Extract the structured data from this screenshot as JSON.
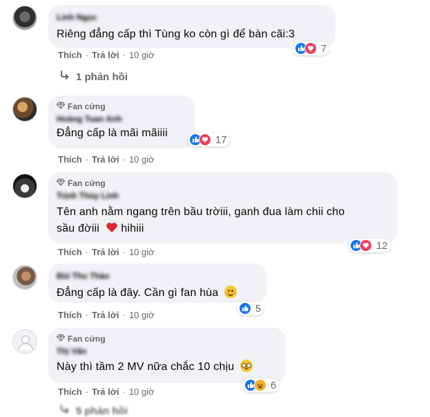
{
  "comments": [
    {
      "author": "Linh Ngọc",
      "badge": "",
      "text": "Riêng đẳng cấp thì Tùng ko còn gì để bàn cãi:3",
      "reactions": {
        "types": [
          "like",
          "love"
        ],
        "count": "7"
      },
      "like_label": "Thích",
      "reply_label": "Trả lời",
      "time": "10 giờ"
    },
    {
      "author": "Hoàng Tuan Anh",
      "badge": "Fan cứng",
      "text": "Đẳng cấp là mãi mãiiii",
      "reactions": {
        "types": [
          "like",
          "love"
        ],
        "count": "17"
      },
      "like_label": "Thích",
      "reply_label": "Trả lời",
      "time": "10 giờ"
    },
    {
      "author": "Trịnh Thùy Linh",
      "badge": "Fan cứng",
      "text_line1": "Tên anh nằm ngang trên bầu trờiii, ganh đua làm chii cho",
      "text_line2": "sầu đờiii",
      "text_line2_tail": "hihiii",
      "reactions": {
        "types": [
          "like",
          "love"
        ],
        "count": "12"
      },
      "like_label": "Thích",
      "reply_label": "Trả lời",
      "time": "10 giờ"
    },
    {
      "author": "Bùi Thu Thảo",
      "badge": "",
      "text": "Đẳng cấp là đây. Cần gì fan hùa",
      "reactions": {
        "types": [
          "like"
        ],
        "count": "5"
      },
      "like_label": "Thích",
      "reply_label": "Trả lời",
      "time": "10 giờ"
    },
    {
      "author": "Thị Vân",
      "badge": "Fan cứng",
      "text": "Này thì tầm 2 MV nữa chắc 10 chịu",
      "reactions": {
        "types": [
          "like",
          "haha"
        ],
        "count": "6"
      },
      "like_label": "Thích",
      "reply_label": "Trả lời",
      "time": "10 giờ"
    }
  ],
  "replies_toggle": {
    "label": "1 phản hồi"
  },
  "more_replies": {
    "label": "5 phản hồi"
  },
  "icons": {
    "badge": "diamond-icon",
    "reply_arrow": "reply-arrow-icon",
    "like": "like-icon",
    "love": "love-icon",
    "haha": "haha-icon"
  },
  "colors": {
    "bubble": "#f0f2f5",
    "meta_text": "#65676b",
    "like_blue": "#1877f2",
    "love_red": "#f33e58",
    "haha_yellow": "#f7b125"
  }
}
